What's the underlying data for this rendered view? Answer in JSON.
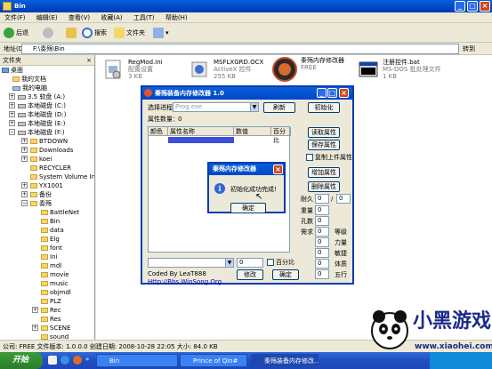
{
  "window": {
    "title": "Bin"
  },
  "menu": [
    "文件(F)",
    "编辑(E)",
    "查看(V)",
    "收藏(A)",
    "工具(T)",
    "帮助(H)"
  ],
  "toolbar": {
    "back": "后退",
    "search": "搜索",
    "folders": "文件夹"
  },
  "address": {
    "label": "地址(D)",
    "value": "F:\\奏殇\\Bin",
    "go": "转到"
  },
  "folder_pane": {
    "title": "文件夹"
  },
  "tree": [
    {
      "label": "桌面"
    },
    {
      "label": "我的文档"
    },
    {
      "label": "我的电脑"
    },
    {
      "label": "3.5 软盘 (A:)"
    },
    {
      "label": "本地磁盘 (C:)"
    },
    {
      "label": "本地磁盘 (D:)"
    },
    {
      "label": "本地磁盘 (E:)"
    },
    {
      "label": "本地磁盘 (F:)"
    },
    {
      "label": "BTDOWN"
    },
    {
      "label": "Downloads"
    },
    {
      "label": "koei"
    },
    {
      "label": "RECYCLER"
    },
    {
      "label": "System Volume Information"
    },
    {
      "label": "YX1001"
    },
    {
      "label": "备份"
    },
    {
      "label": "奏殇"
    },
    {
      "label": "BattleNet"
    },
    {
      "label": "Bin"
    },
    {
      "label": "data"
    },
    {
      "label": "Elg"
    },
    {
      "label": "font"
    },
    {
      "label": "Ini"
    },
    {
      "label": "mdl"
    },
    {
      "label": "movie"
    },
    {
      "label": "music"
    },
    {
      "label": "objmdl"
    },
    {
      "label": "PLZ"
    },
    {
      "label": "Rec"
    },
    {
      "label": "Res"
    },
    {
      "label": "SCENE"
    },
    {
      "label": "sound"
    },
    {
      "label": "System"
    },
    {
      "label": "CD-RW 驱动器 (G:)"
    }
  ],
  "files": [
    {
      "name": "RegMod.ini",
      "desc": "配置设置",
      "size": "3 KB"
    },
    {
      "name": "MSFLXGRD.OCX",
      "desc": "ActiveX 控件",
      "size": "255 KB"
    },
    {
      "name": "秦殇内存修改器",
      "desc": "FREE",
      "size": ""
    },
    {
      "name": "注册控件.bat",
      "desc": "MS-DOS 批处理文件",
      "size": "1 KB"
    }
  ],
  "status": "公司: FREE 文件版本: 1.0.0.0 创建日期: 2008-10-28 22:05 大小: 84.0 KB",
  "taskbar": {
    "start": "开始",
    "tasks": [
      "Bin",
      "Prince of Qin#",
      "秦殇装备内存修改..."
    ]
  },
  "app": {
    "title": "秦殇装备内存修改器 1.0",
    "select_process_label": "选择进程",
    "process_value": "Prog.exe",
    "refresh": "刷新",
    "init": "初始化",
    "attr_count_label": "属性数量：",
    "attr_count": "0",
    "columns": [
      "颜色",
      "属性名称",
      "数值",
      "百分比"
    ],
    "buttons": [
      "读取属性",
      "保存属性",
      "复制上件属性",
      "增加属性",
      "删除属性"
    ],
    "copy_check_label": "复制上件属性",
    "stats": [
      {
        "label": "耐久",
        "value": "0",
        "value2": "0"
      },
      {
        "label": "重量",
        "value": "0"
      },
      {
        "label": "孔数",
        "value": "0"
      },
      {
        "label": "需求",
        "value": "0"
      }
    ],
    "req_labels": [
      "等级",
      "力量",
      "敏捷",
      "体质",
      "五行"
    ],
    "req_values": [
      "0",
      "0",
      "0",
      "0",
      "0"
    ],
    "bottom_value": "0",
    "percent_label": "百分比",
    "credit": "Coded By LeaT888",
    "url": "Http://Bbs.WinSong.Org",
    "modify": "修改",
    "confirm": "确定"
  },
  "dialog": {
    "title": "秦殇内存修改器",
    "message": "初始化成功完成!",
    "ok": "确定"
  },
  "watermark": {
    "brand": "小黑游戏",
    "url": "www.xiaohei.com"
  }
}
